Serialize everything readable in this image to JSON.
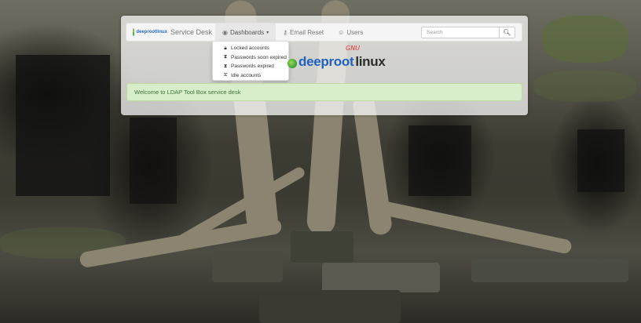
{
  "navbar": {
    "brand_logo_text": "deeprootlinux",
    "brand_title": "Service Desk",
    "items": [
      {
        "label": "Dashboards",
        "icon": "dashboard-icon"
      },
      {
        "label": "Email Reset",
        "icon": "key-icon"
      },
      {
        "label": "Users",
        "icon": "user-icon"
      }
    ],
    "search": {
      "placeholder": "Search",
      "button_icon": "search-icon"
    }
  },
  "dropdown": {
    "items": [
      {
        "label": "Locked accounts",
        "icon": "lock-icon"
      },
      {
        "label": "Passwords soon expired",
        "icon": "hourglass-half-icon"
      },
      {
        "label": "Passwords expired",
        "icon": "hourglass-end-icon"
      },
      {
        "label": "Idle accounts",
        "icon": "hourglass-empty-icon"
      }
    ]
  },
  "logo": {
    "word_part1": "deeproot",
    "word_part2": "linux",
    "tag": "GNU"
  },
  "alert": {
    "message": "Welcome to LDAP Tool Box service desk"
  },
  "colors": {
    "alert_bg": "#d8edc9",
    "alert_text": "#3c763d",
    "logo_blue": "#2061c0",
    "gnu_red": "#dd3333"
  }
}
